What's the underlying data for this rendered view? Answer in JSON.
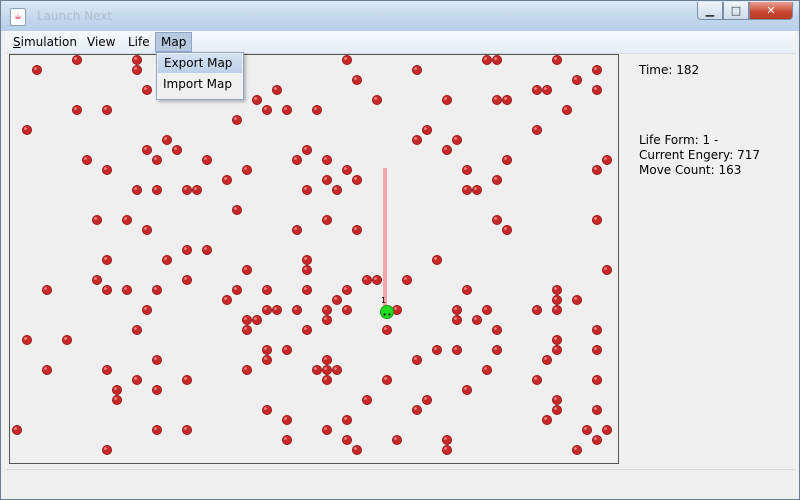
{
  "window": {
    "title": "Launch Next",
    "app_icon": "java-cup-icon",
    "controls": [
      "minimize-icon",
      "maximize-icon",
      "close-icon"
    ]
  },
  "menubar": {
    "simulation": {
      "first": "S",
      "rest": "imulation"
    },
    "view": "View",
    "life": "Life",
    "map": "Map"
  },
  "map_menu": {
    "items": [
      "Export Map",
      "Import Map"
    ],
    "highlighted": "Export Map"
  },
  "info": {
    "time": "Time: 182",
    "life_form": "Life Form: 1 -",
    "energy": "Current Engery: 717",
    "moves": "Move Count: 163"
  },
  "creature": {
    "label": "1",
    "color": "#22dd22",
    "trail_color": "#f4a6a6"
  },
  "food_color": "#c82828"
}
